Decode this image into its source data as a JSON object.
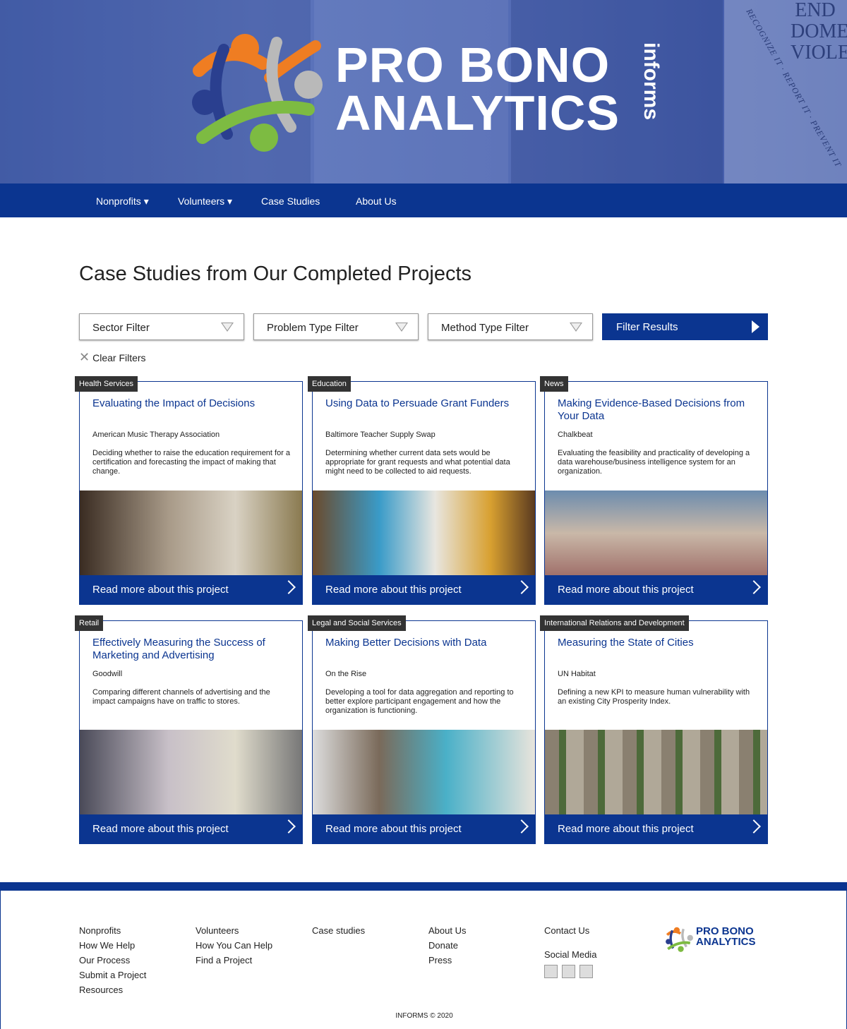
{
  "brand": {
    "line1": "PRO BONO",
    "line2": "ANALYTICS",
    "sub": "informs",
    "banner_text": "END DOMESTIC VIOLENCE",
    "ribbon_text": "RECOGNIZE IT · REPORT IT · PREVENT IT"
  },
  "nav": [
    {
      "label": "Nonprofits",
      "dropdown": true
    },
    {
      "label": "Volunteers",
      "dropdown": true
    },
    {
      "label": "Case Studies"
    },
    {
      "label": "About Us"
    }
  ],
  "page_title": "Case Studies from Our Completed Projects",
  "filters": {
    "sector": "Sector Filter",
    "problem": "Problem Type Filter",
    "method": "Method Type Filter",
    "submit": "Filter Results",
    "clear": "Clear Filters"
  },
  "cards": [
    {
      "tag": "Health Services",
      "title": "Evaluating the Impact of Decisions",
      "org": "American Music Therapy Association",
      "desc": "Deciding whether to raise the education requirement for a certification and forecasting the impact of making that change.",
      "link": "Read more about this project"
    },
    {
      "tag": "Education",
      "title": "Using Data to Persuade Grant Funders",
      "org": "Baltimore Teacher Supply Swap",
      "desc": "Determining whether current data sets would be appropriate for grant requests and what potential data might need to be collected to aid requests.",
      "link": "Read more about this project"
    },
    {
      "tag": "News",
      "title": "Making Evidence-Based Decisions from Your Data",
      "org": "Chalkbeat",
      "desc": "Evaluating the feasibility and practicality of developing a data warehouse/business intelligence system for an organization.",
      "link": "Read more about this project"
    },
    {
      "tag": "Retail",
      "title": "Effectively Measuring the Success of Marketing and Advertising",
      "org": "Goodwill",
      "desc": "Comparing different channels of advertising and the impact campaigns have on traffic to stores.",
      "link": "Read more about this project"
    },
    {
      "tag": "Legal and Social Services",
      "title": "Making Better Decisions with Data",
      "org": "On the Rise",
      "desc": "Developing a tool for data aggregation and reporting to better explore participant engagement and how the organization is functioning.",
      "link": "Read more about this project"
    },
    {
      "tag": "International Relations and Development",
      "title": "Measuring the State of Cities",
      "org": "UN Habitat",
      "desc": "Defining a new KPI to measure human vulnerability with an existing City Prosperity Index.",
      "link": "Read more about this project"
    }
  ],
  "footer": {
    "cols": [
      {
        "head": "Nonprofits",
        "items": [
          "How We Help",
          "Our Process",
          "Submit a Project",
          "Resources"
        ]
      },
      {
        "head": "Volunteers",
        "items": [
          "How You Can Help",
          "Find a Project"
        ]
      },
      {
        "head": "Case studies",
        "items": []
      },
      {
        "head": "About Us",
        "items": [
          "Donate",
          "Press"
        ]
      }
    ],
    "contact": "Contact Us",
    "social": "Social Media",
    "copyright": "INFORMS © 2020"
  },
  "colors": {
    "primary": "#0b3590",
    "tag": "#333333",
    "orange": "#ef7d22",
    "green": "#7dbb42",
    "gray": "#b9b9b9"
  }
}
